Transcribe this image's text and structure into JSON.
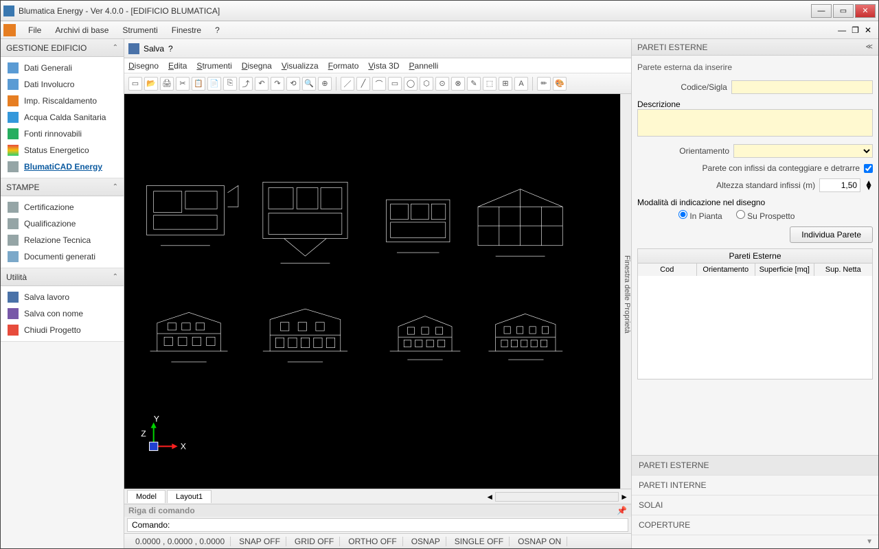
{
  "titlebar": {
    "title": "Blumatica Energy - Ver 4.0.0 - [EDIFICIO BLUMATICA]"
  },
  "menubar": {
    "items": [
      "File",
      "Archivi di base",
      "Strumenti",
      "Finestre",
      "?"
    ]
  },
  "left": {
    "sections": [
      {
        "title": "GESTIONE EDIFICIO",
        "items": [
          {
            "label": "Dati Generali",
            "icon": "blue"
          },
          {
            "label": "Dati Involucro",
            "icon": "blue"
          },
          {
            "label": "Imp. Riscaldamento",
            "icon": "fire"
          },
          {
            "label": "Acqua Calda Sanitaria",
            "icon": "water"
          },
          {
            "label": "Fonti rinnovabili",
            "icon": "leaf"
          },
          {
            "label": "Status Energetico",
            "icon": "energy"
          },
          {
            "label": "BlumatiCAD Energy",
            "icon": "doc",
            "active": true
          }
        ]
      },
      {
        "title": "STAMPE",
        "items": [
          {
            "label": "Certificazione",
            "icon": "doc"
          },
          {
            "label": "Qualificazione",
            "icon": "doc"
          },
          {
            "label": "Relazione Tecnica",
            "icon": "doc"
          },
          {
            "label": "Documenti  generati",
            "icon": "folder"
          }
        ]
      },
      {
        "title": "Utilità",
        "items": [
          {
            "label": "Salva lavoro",
            "icon": "save"
          },
          {
            "label": "Salva con nome",
            "icon": "saveas"
          },
          {
            "label": "Chiudi Progetto",
            "icon": "close"
          }
        ]
      }
    ]
  },
  "doc_toolbar": {
    "save": "Salva",
    "help": "?"
  },
  "cad_menu": [
    "Disegno",
    "Edita",
    "Strumenti",
    "Disegna",
    "Visualizza",
    "Formato",
    "Vista 3D",
    "Pannelli"
  ],
  "prop_sidebar": "Finestra delle Proprietà",
  "cad_tabs": {
    "model": "Model",
    "layout": "Layout1"
  },
  "cmd": {
    "header": "Riga di comando",
    "label": "Comando:"
  },
  "status": {
    "coords": "0.0000 , 0.0000 , 0.0000",
    "cells": [
      "SNAP OFF",
      "GRID OFF",
      "ORTHO OFF",
      "OSNAP",
      "SINGLE OFF",
      "OSNAP ON"
    ]
  },
  "right": {
    "title": "PARETI ESTERNE",
    "group": "Parete esterna da inserire",
    "labels": {
      "code": "Codice/Sigla",
      "desc": "Descrizione",
      "orient": "Orientamento",
      "check": "Parete con infissi da conteggiare e detrarre",
      "height": "Altezza standard infissi (m)",
      "height_val": "1,50",
      "mode": "Modalità di indicazione nel disegno",
      "radio1": "In Pianta",
      "radio2": "Su Prospetto",
      "button": "Individua Parete"
    },
    "table": {
      "title": "Pareti Esterne",
      "cols": [
        "Cod",
        "Orientamento",
        "Superficie [mq]",
        "Sup. Netta"
      ]
    },
    "tabs": [
      "PARETI ESTERNE",
      "PARETI INTERNE",
      "SOLAI",
      "COPERTURE"
    ]
  }
}
